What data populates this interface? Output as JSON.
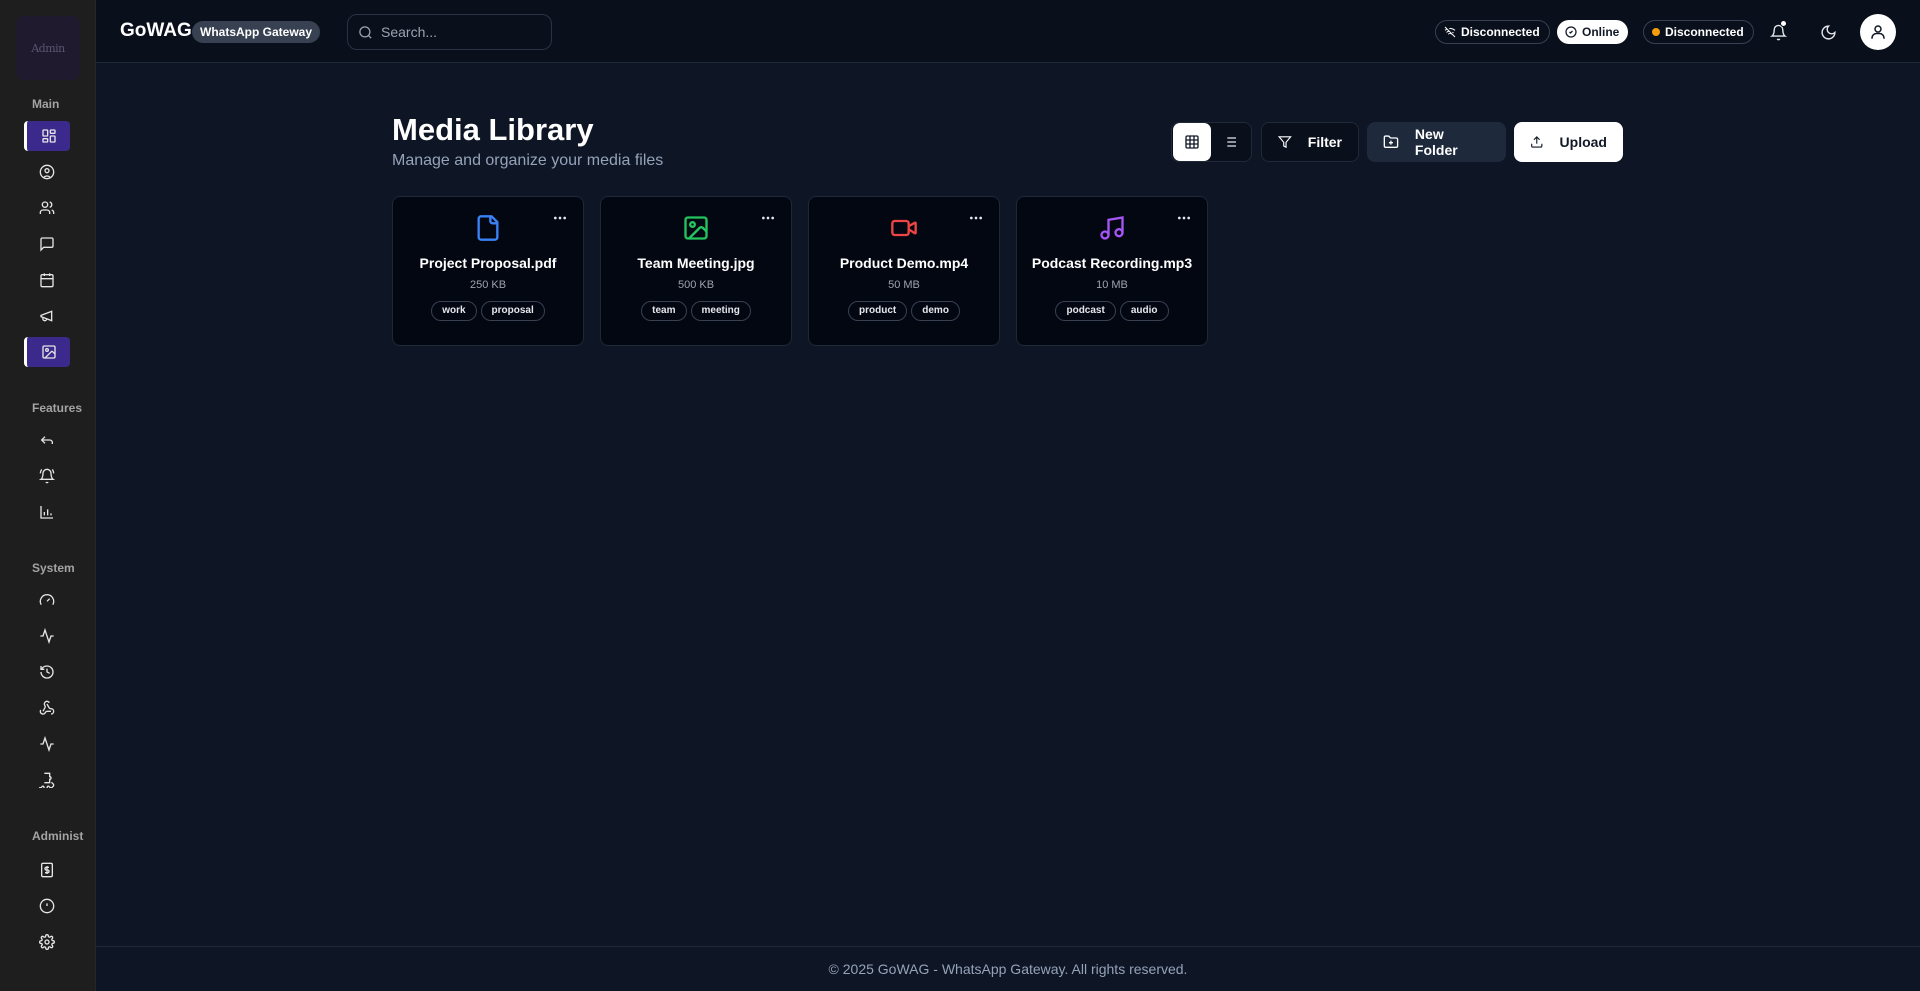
{
  "app": {
    "brand": "GoWAG",
    "badge": "WhatsApp Gateway",
    "logo_text": "Admin"
  },
  "search": {
    "placeholder": "Search..."
  },
  "status": {
    "wifi_label": "Disconnected",
    "online_label": "Online",
    "server_label": "Disconnected",
    "server_dot_color": "#f59e0b"
  },
  "sidebar": {
    "sections": [
      "Main",
      "Features",
      "System",
      "Administ"
    ],
    "main_items": [
      {
        "icon": "dashboard-icon",
        "active": true
      },
      {
        "icon": "user-circle-icon"
      },
      {
        "icon": "contacts-icon"
      },
      {
        "icon": "message-icon"
      },
      {
        "icon": "calendar-icon"
      },
      {
        "icon": "megaphone-icon"
      },
      {
        "icon": "image-icon",
        "active": true
      }
    ],
    "feature_items": [
      {
        "icon": "reply-icon"
      },
      {
        "icon": "alarm-icon"
      },
      {
        "icon": "bar-chart-icon"
      }
    ],
    "system_items": [
      {
        "icon": "gauge-icon"
      },
      {
        "icon": "activity-icon"
      },
      {
        "icon": "history-icon"
      },
      {
        "icon": "webhook-icon"
      },
      {
        "icon": "pulse-icon"
      },
      {
        "icon": "puzzle-icon"
      }
    ],
    "admin_items": [
      {
        "icon": "billing-icon"
      },
      {
        "icon": "alert-icon"
      },
      {
        "icon": "settings-icon"
      }
    ]
  },
  "page": {
    "title": "Media Library",
    "subtitle": "Manage and organize your media files"
  },
  "actions": {
    "filter": "Filter",
    "new_folder": "New Folder",
    "upload": "Upload"
  },
  "files": [
    {
      "name": "Project Proposal.pdf",
      "size": "250 KB",
      "tags": [
        "work",
        "proposal"
      ],
      "icon": "file-icon",
      "color": "#3b82f6"
    },
    {
      "name": "Team Meeting.jpg",
      "size": "500 KB",
      "tags": [
        "team",
        "meeting"
      ],
      "icon": "image-icon",
      "color": "#22c55e"
    },
    {
      "name": "Product Demo.mp4",
      "size": "50 MB",
      "tags": [
        "product",
        "demo"
      ],
      "icon": "video-icon",
      "color": "#ef4444"
    },
    {
      "name": "Podcast Recording.mp3",
      "size": "10 MB",
      "tags": [
        "podcast",
        "audio"
      ],
      "icon": "music-icon",
      "color": "#a855f7"
    }
  ],
  "footer": {
    "text": "© 2025 GoWAG - WhatsApp Gateway. All rights reserved."
  }
}
